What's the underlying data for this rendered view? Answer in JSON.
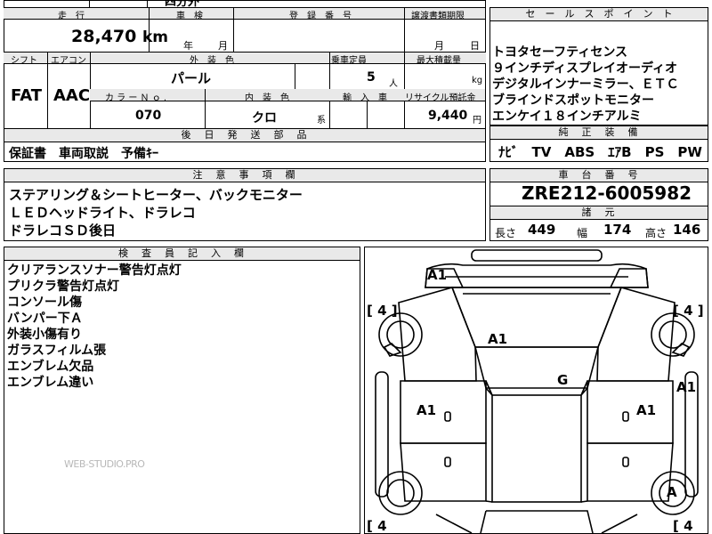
{
  "top_cut": "四分外",
  "mileage": {
    "label": "走　行",
    "value": "28,470",
    "unit": "km"
  },
  "inspection": {
    "label": "車　検",
    "year": "年",
    "month": "月"
  },
  "registration": {
    "label": "登　録　番　号"
  },
  "transfer_deadline": {
    "label": "譲渡書類期限",
    "month": "月",
    "day": "日"
  },
  "shift": {
    "label": "シフト",
    "value": "FAT"
  },
  "aircon": {
    "label": "エアコン",
    "value": "AAC"
  },
  "exterior_color": {
    "label": "外　装　色",
    "value": "パール"
  },
  "capacity": {
    "label": "乗車定員",
    "value": "5",
    "unit": "人"
  },
  "max_load": {
    "label": "最大積載量",
    "unit": "kg"
  },
  "color_no": {
    "label": "カ ラ ー Ｎ ｏ .",
    "value": "070"
  },
  "interior_color": {
    "label": "内　装　色",
    "value": "クロ",
    "suffix": "系"
  },
  "import": {
    "label": "輸　入　車"
  },
  "recycle": {
    "label": "リサイクル預託金",
    "value": "9,440",
    "unit": "円"
  },
  "delivery_parts": {
    "label": "後　日　発　送　部　品",
    "value": "保証書　車両取説　予備ｷｰ"
  },
  "notes": {
    "label": "注　意　事　項　欄",
    "lines": [
      "ステアリング＆シートヒーター、バックモニター",
      "ＬＥＤヘッドライト、ドラレコ",
      "ドラレコＳＤ後日"
    ]
  },
  "inspector": {
    "label": "検　査　員　記　入　欄",
    "lines": [
      "クリアランスソナー警告灯点灯",
      "プリクラ警告灯点灯",
      "コンソール傷",
      "バンパー下Ａ",
      "外装小傷有り",
      "ガラスフィルム張",
      "エンブレム欠品",
      "エンブレム違い"
    ]
  },
  "sales_points": {
    "label": "セ　ー　ル　ス　ポ　イ　ン　ト",
    "lines": [
      "トヨタセーフティセンス",
      "９インチディスプレイオーディオ",
      "デジタルインナーミラー、ＥＴＣ",
      "ブラインドスポットモニター",
      "エンケイ１８インチアルミ"
    ]
  },
  "factory_equipment": {
    "label": "純　正　装　備",
    "value": "ﾅﾋﾞ　TV　ABS　ｴｱB　PS　PW"
  },
  "chassis": {
    "label": "車　台　番　号",
    "value": "ZRE212-6005982"
  },
  "specs": {
    "label": "諸　元",
    "length_label": "長さ",
    "length": "449",
    "width_label": "幅",
    "width": "174",
    "height_label": "高さ",
    "height": "146"
  },
  "diagram": {
    "marks": {
      "front": "A1",
      "hood": "A1",
      "roof": "G",
      "left_door": "A1",
      "right_door": "A1",
      "right_side": "A1",
      "rear_right_wheel": "A"
    },
    "tires": {
      "fl": "4",
      "fr": "4",
      "rl": "4",
      "rr": "4"
    }
  },
  "watermark": "WEB-STUDIO.PRO"
}
